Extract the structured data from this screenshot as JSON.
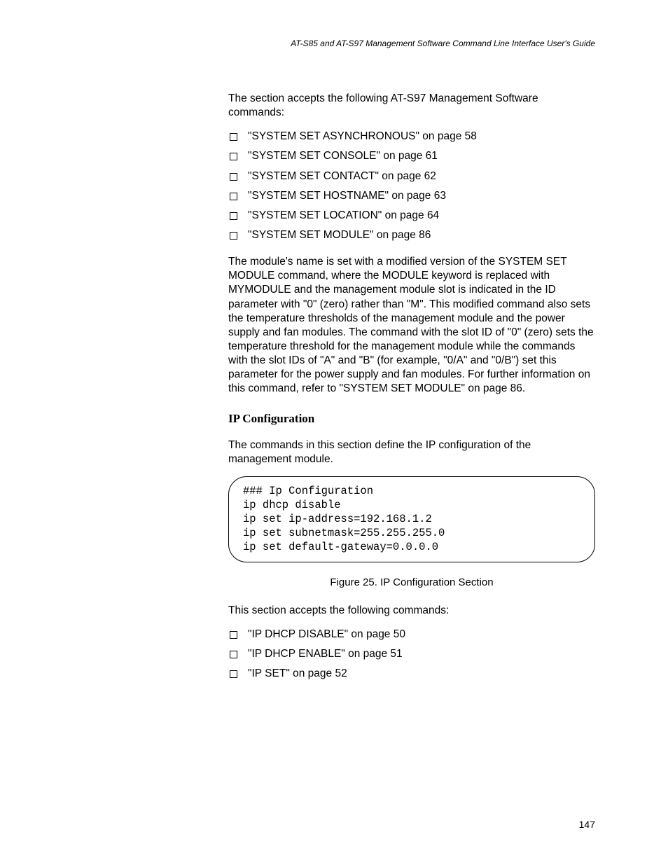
{
  "header": {
    "guide_title": "AT-S85 and AT-S97 Management Software Command Line Interface User's Guide"
  },
  "intro_paragraph": "The section accepts the following AT-S97 Management Software commands:",
  "commands_list_1": [
    "\"SYSTEM SET ASYNCHRONOUS\" on page 58",
    "\"SYSTEM SET CONSOLE\" on page 61",
    "\"SYSTEM SET CONTACT\" on page 62",
    "\"SYSTEM SET HOSTNAME\" on page 63",
    "\"SYSTEM SET LOCATION\" on page 64",
    "\"SYSTEM SET MODULE\" on page 86"
  ],
  "module_paragraph": "The module's name is set with a modified version of the SYSTEM SET MODULE command, where the MODULE keyword is replaced with MYMODULE and the management module slot is indicated in the ID parameter with \"0\" (zero) rather than \"M\". This modified command also sets the temperature thresholds of the management module and the power supply and fan modules. The command with the slot ID of \"0\" (zero) sets the temperature threshold for the management module while the commands with the slot IDs of \"A\" and \"B\" (for example, \"0/A\" and \"0/B\") set this parameter for the power supply and fan modules. For further information on this command, refer to \"SYSTEM SET MODULE\" on page 86.",
  "section_heading": "IP Configuration",
  "ip_intro": "The commands in this section define the IP configuration of the management module.",
  "code_block": "### Ip Configuration\nip dhcp disable\nip set ip-address=192.168.1.2\nip set subnetmask=255.255.255.0\nip set default-gateway=0.0.0.0",
  "figure_caption": "Figure 25. IP Configuration Section",
  "commands_intro_2": "This section accepts the following commands:",
  "commands_list_2": [
    "\"IP DHCP DISABLE\" on page 50",
    "\"IP DHCP ENABLE\" on page 51",
    "\"IP SET\" on page 52"
  ],
  "page_number": "147"
}
